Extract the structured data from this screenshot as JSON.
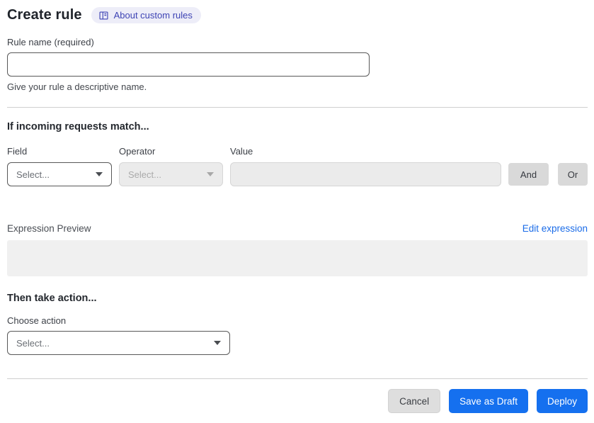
{
  "header": {
    "title": "Create rule",
    "about_badge_label": "About custom rules"
  },
  "rule_name": {
    "label": "Rule name (required)",
    "value": "",
    "helper": "Give your rule a descriptive name."
  },
  "match_section": {
    "heading": "If incoming requests match...",
    "field": {
      "label": "Field",
      "placeholder": "Select..."
    },
    "operator": {
      "label": "Operator",
      "placeholder": "Select..."
    },
    "value": {
      "label": "Value",
      "value": ""
    },
    "and_button": "And",
    "or_button": "Or"
  },
  "expression": {
    "label": "Expression Preview",
    "edit_link": "Edit expression",
    "preview_text": ""
  },
  "action_section": {
    "heading": "Then take action...",
    "choose_label": "Choose action",
    "placeholder": "Select..."
  },
  "footer": {
    "cancel": "Cancel",
    "save_draft": "Save as Draft",
    "deploy": "Deploy"
  },
  "icons": {
    "about_badge_icon": "book-icon",
    "select_caret": "chevron-down-icon"
  },
  "colors": {
    "primary_blue": "#1570ef",
    "link_blue": "#1b6ce8",
    "badge_bg": "#ededf8",
    "badge_text": "#3d43b4",
    "disabled_bg": "#ebebeb",
    "connector_gray": "#d9d9d9",
    "preview_box_gray": "#f0f0f0"
  }
}
